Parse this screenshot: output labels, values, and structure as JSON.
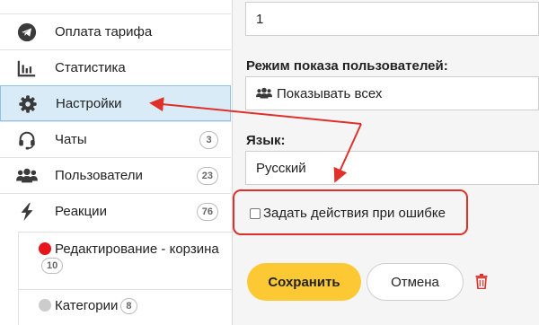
{
  "sidebar": {
    "items": [
      {
        "label": "Оплата тарифа",
        "icon": "telegram-icon"
      },
      {
        "label": "Статистика",
        "icon": "bar-chart-icon"
      },
      {
        "label": "Настройки",
        "icon": "gear-icon"
      },
      {
        "label": "Чаты",
        "icon": "headset-icon",
        "badge": "3"
      },
      {
        "label": "Пользователи",
        "icon": "users-icon",
        "badge": "23"
      },
      {
        "label": "Реакции",
        "icon": "lightning-icon",
        "badge": "76"
      }
    ],
    "subitems": [
      {
        "label": "Редактирование - корзина",
        "badge": "10",
        "dot_color": "#e8141b"
      },
      {
        "label": "Категории",
        "badge": "8",
        "dot_color": "#cccccc"
      }
    ]
  },
  "main": {
    "number_value": "1",
    "display_mode_label": "Режим показа пользователей:",
    "display_mode_value": "Показывать всех",
    "language_label": "Язык:",
    "language_value": "Русский",
    "error_actions_label": "Задать действия при ошибке",
    "save_label": "Сохранить",
    "cancel_label": "Отмена"
  },
  "colors": {
    "accent_yellow": "#fcc934",
    "annotation_red": "#e0302a",
    "active_item_bg": "#d9ebf7"
  }
}
